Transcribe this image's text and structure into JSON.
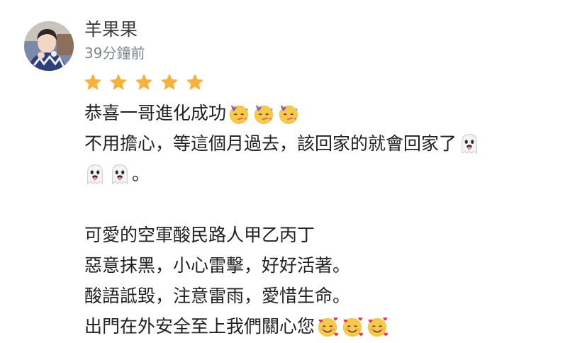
{
  "review": {
    "author": "羊果果",
    "time_ago": "39分鐘前",
    "rating": 5,
    "star_color": "#f6b23a",
    "lines": {
      "l1": "恭喜一哥進化成功",
      "l2": "不用擔心，等這個月過去，該回家的就會回家了",
      "l3": "。",
      "l5": "可愛的空軍酸民路人甲乙丙丁",
      "l6": "惡意抹黑，小心雷擊，好好活著。",
      "l7": "酸語詆毀，注意雷雨，愛惜生命。",
      "l8": "出門在外安全至上我們關心您"
    },
    "emoji_names": {
      "party": "partying-face-emoji",
      "ghost": "ghost-tongue-emoji",
      "hearts": "smiling-face-with-hearts-emoji"
    }
  }
}
